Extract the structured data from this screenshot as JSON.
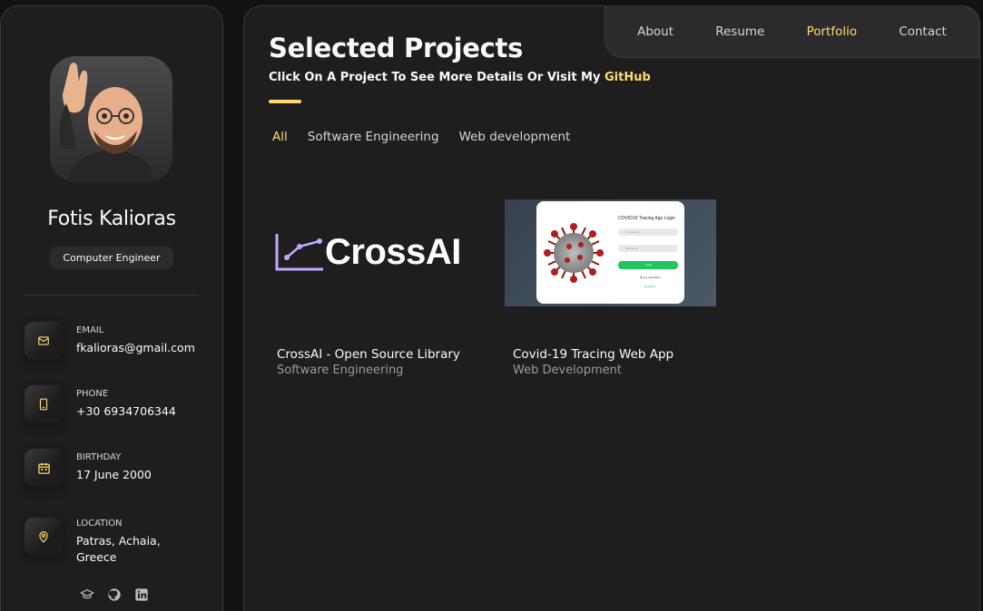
{
  "sidebar": {
    "name": "Fotis Kalioras",
    "title": "Computer Engineer",
    "contacts": [
      {
        "icon": "mail-icon",
        "label": "EMAIL",
        "value": "fkalioras@gmail.com"
      },
      {
        "icon": "phone-icon",
        "label": "PHONE",
        "value": "+30 6934706344"
      },
      {
        "icon": "calendar-icon",
        "label": "BIRTHDAY",
        "value": "17 June 2000"
      },
      {
        "icon": "location-pin-icon",
        "label": "LOCATION",
        "value": "Patras, Achaia, Greece"
      }
    ],
    "socials": [
      "graduation-cap-icon",
      "github-icon",
      "linkedin-icon"
    ]
  },
  "navbar": {
    "links": [
      "About",
      "Resume",
      "Portfolio",
      "Contact"
    ],
    "active": "Portfolio"
  },
  "portfolio": {
    "title": "Selected Projects",
    "subtitle_prefix": "Click On A Project To See More Details Or Visit My ",
    "subtitle_link": "GitHub",
    "filters": [
      "All",
      "Software Engineering",
      "Web development"
    ],
    "active_filter": "All",
    "projects": [
      {
        "title": "CrossAI - Open Source Library",
        "category": "Software Engineering",
        "logo_text": "CrossAI"
      },
      {
        "title": "Covid-19 Tracing Web App",
        "category": "Web Development",
        "screenshot_heading": "COVID19 Tracing App Login",
        "username_placeholder": "Username",
        "password_placeholder": "Password",
        "login_label": "Login",
        "forgot_label": "Not a member?",
        "register_label": "Register"
      }
    ]
  },
  "colors": {
    "accent": "#ffdb70",
    "background": "#121212",
    "panel": "#1e1e1f"
  }
}
